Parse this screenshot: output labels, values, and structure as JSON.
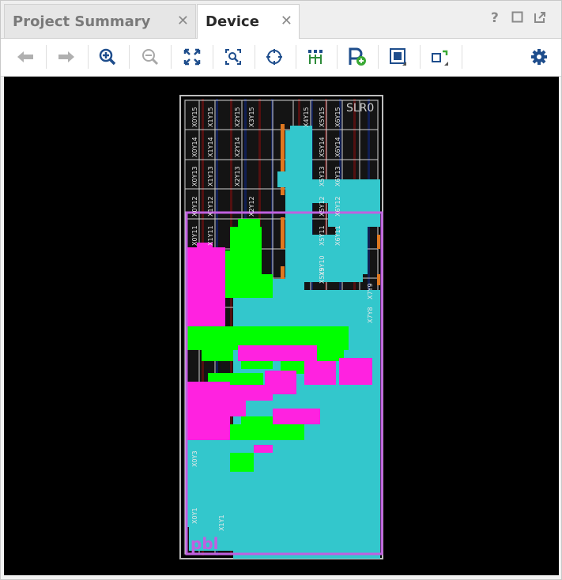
{
  "tabs": [
    {
      "label": "Project Summary",
      "active": false
    },
    {
      "label": "Device",
      "active": true
    }
  ],
  "window_controls": {
    "help": "?"
  },
  "toolbar": {
    "buttons": [
      "back-arrow-icon",
      "forward-arrow-icon",
      "zoom-in-icon",
      "zoom-out-icon",
      "zoom-fit-icon",
      "zoom-selection-icon",
      "autofit-selection-icon",
      "routing-resources-icon",
      "add-pblock-icon",
      "draw-pblock-icon",
      "draw-box-icon",
      "settings-gear-icon"
    ]
  },
  "device": {
    "slr_label": "SLR0",
    "top_column_labels": [
      "X0Y15",
      "X1Y15",
      "X2Y15",
      "X3Y15",
      "X4Y15",
      "X5Y15",
      "X6Y15"
    ],
    "row_labels_x0": [
      "X0Y14",
      "X0Y13",
      "X0Y12",
      "X0Y11",
      "X0Y3",
      "X0Y1"
    ],
    "row_labels_x1": [
      "X1Y14",
      "X1Y13",
      "X1Y12",
      "X1Y11",
      "X1Y1"
    ],
    "row_labels_x2": [
      "X2Y14",
      "X2Y13",
      "X2Y12"
    ],
    "row_labels_x5": [
      "X5Y14",
      "X5Y13",
      "X5Y12",
      "X5Y11",
      "X5Y10",
      "X5Y9"
    ],
    "row_labels_x6": [
      "X6Y14",
      "X6Y13",
      "X6Y12",
      "X6Y11"
    ],
    "row_labels_x7": [
      "X7Y9",
      "X7Y8"
    ],
    "pblock_text": "pbl",
    "colors": {
      "background": "#000000",
      "fabric": "#151515",
      "grid": "#cfcfcf",
      "pblock_border": "#c060e0",
      "cyan_logic": "#33c7cc",
      "green_logic": "#00ff00",
      "magenta_logic": "#ff22e0",
      "orange_io": "#e07820",
      "gray_column": "#9a9a9a"
    }
  }
}
